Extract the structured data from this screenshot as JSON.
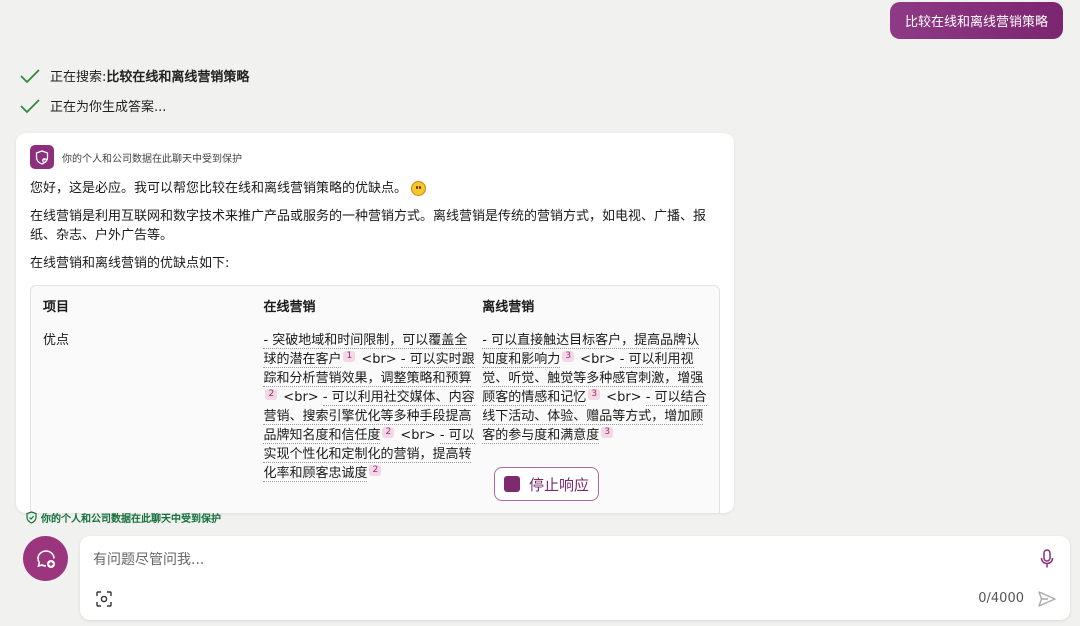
{
  "user_message": "比较在线和离线营销策略",
  "status": {
    "searching_label": "正在搜索: ",
    "searching_query": "比较在线和离线营销策略",
    "generating": "正在为你生成答案..."
  },
  "card": {
    "protection_note": "你的个人和公司数据在此聊天中受到保护",
    "greeting": "您好，这是必应。我可以帮您比较在线和离线营销策略的优缺点。",
    "paragraph1": "在线营销是利用互联网和数字技术来推广产品或服务的一种营销方式。离线营销是传统的营销方式，如电视、广播、报纸、杂志、户外广告等。",
    "paragraph2": "在线营销和离线营销的优缺点如下:",
    "table": {
      "headers": [
        "项目",
        "在线营销",
        "离线营销"
      ],
      "row1_label": "优点",
      "online": {
        "s1": "- 突破地域和时间限制，可以覆盖全球的潜在客户",
        "c1": "1",
        "br1": " <br> ",
        "s2": "- 可以实时跟踪和分析营销效果，调整策略和预算",
        "c2": "2",
        "br2": " <br> ",
        "s3": "- 可以利用社交媒体、内容营销、搜索引擎优化等多种手段提高品牌知名度和信任度",
        "c3": "2",
        "br3": " <br> ",
        "s4": "- 可以实现个性化和定制化的营销，提高转化率和顾客忠诚度",
        "c4": "2"
      },
      "offline": {
        "s1": "- 可以直接触达目标客户，提高品牌认知度和影响力",
        "c1": "3",
        "br1": " <br> ",
        "s2": "- 可以利用视觉、听觉、触觉等多种感官刺激，增强顾客的情感和记忆",
        "c2": "3",
        "br2": " <br> ",
        "s3": "- 可以结合线下活动、体验、赠品等方式，增加顾客的参与度和满意度",
        "c3": "3"
      }
    }
  },
  "stop_button": "停止响应",
  "footer_protection": "你的个人和公司数据在此聊天中受到保护",
  "input": {
    "placeholder": "有问题尽管问我...",
    "counter": "0/4000"
  },
  "colors": {
    "brand": "#8a2d7c",
    "protect_green": "#15703a",
    "citation_bg": "#f4d7e6"
  }
}
